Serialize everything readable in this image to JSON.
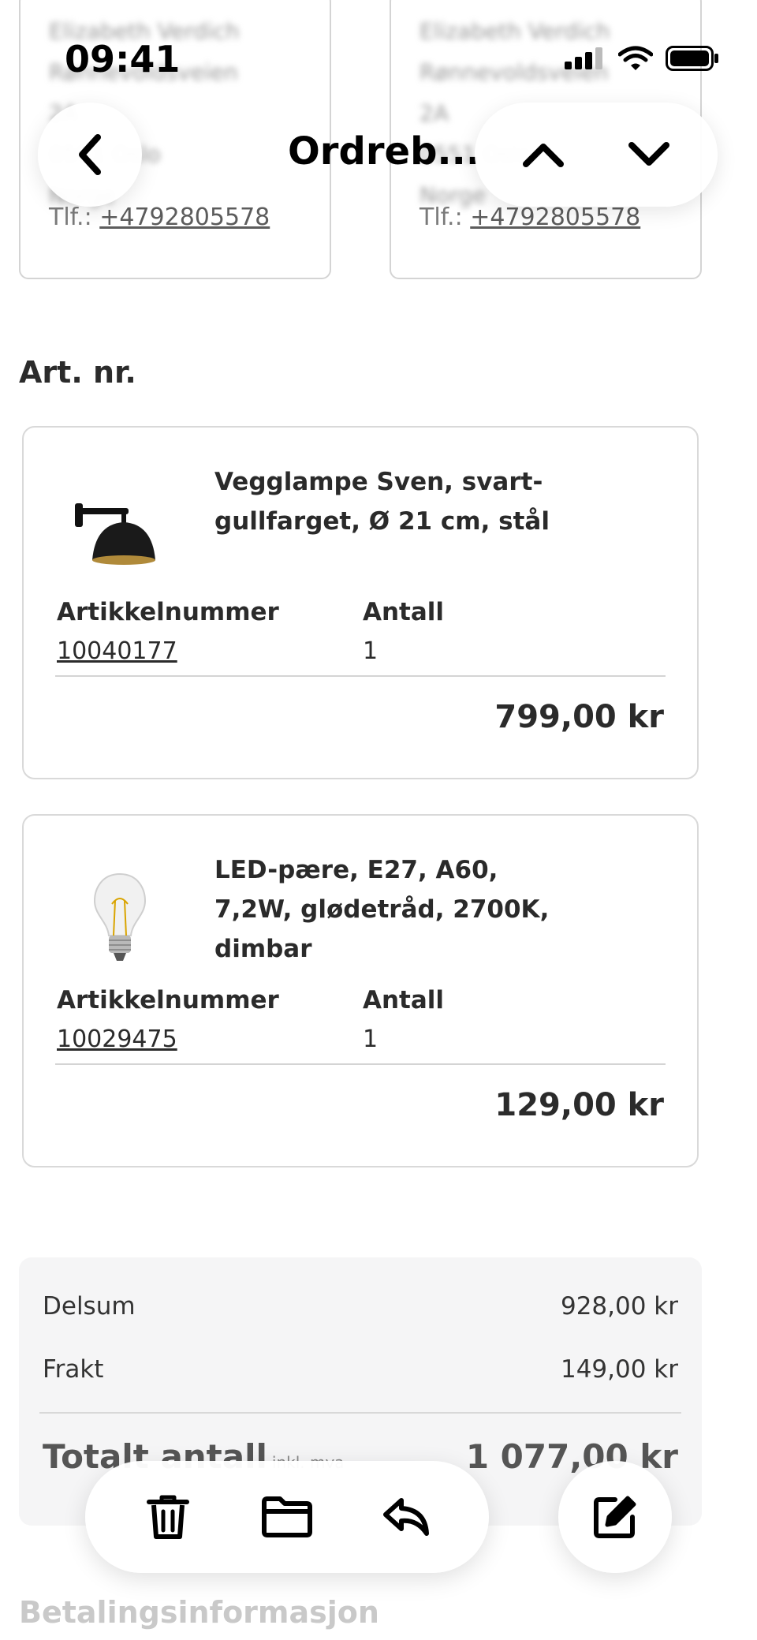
{
  "status_bar": {
    "time": "09:41"
  },
  "header": {
    "title": "Ordreb..."
  },
  "addresses": [
    {
      "lines": [
        "Elizabeth Verdich",
        "Rønnevoldsveien",
        "2A",
        "0551 Oslo",
        "Norge"
      ],
      "phone_prefix": "Tlf.:",
      "phone": "+4792805578"
    },
    {
      "lines": [
        "Elizabeth Verdich",
        "Rønnevoldsveien",
        "2A",
        "0551 Oslo",
        "Norge"
      ],
      "phone_prefix": "Tlf.:",
      "phone": "+4792805578"
    }
  ],
  "items_section": {
    "title": "Art. nr."
  },
  "items": [
    {
      "name": "Vegglampe Sven, svart-gullfarget, Ø 21 cm, stål",
      "article_label": "Artikkelnummer",
      "article_number": "10040177",
      "qty_label": "Antall",
      "qty": "1",
      "price": "799,00 kr",
      "image_icon": "wall-lamp-icon"
    },
    {
      "name": "LED-pære, E27, A60, 7,2W, glødetråd, 2700K, dimbar",
      "article_label": "Artikkelnummer",
      "article_number": "10029475",
      "qty_label": "Antall",
      "qty": "1",
      "price": "129,00 kr",
      "image_icon": "light-bulb-icon"
    }
  ],
  "summary": {
    "subtotal_label": "Delsum",
    "subtotal": "928,00 kr",
    "shipping_label": "Frakt",
    "shipping": "149,00 kr",
    "total_label": "Totalt antall",
    "total_sub": "inkl. mva",
    "total": "1 077,00 kr"
  },
  "toolbar": {
    "icons": [
      "trash-icon",
      "folder-icon",
      "reply-icon",
      "edit-icon"
    ]
  },
  "payment": {
    "title": "Betalingsinformasjon"
  },
  "colors": {
    "text": "#2b2b2b",
    "border": "#d9d9d9",
    "summary_bg": "#f5f5f6"
  }
}
